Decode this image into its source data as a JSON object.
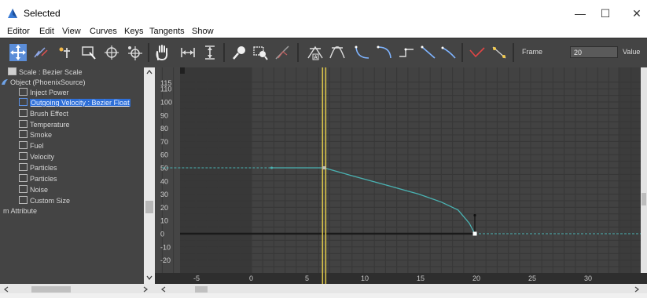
{
  "window": {
    "title": "Selected",
    "minimize": "—",
    "maximize": "☐",
    "close": "✕"
  },
  "menu": [
    "Editor",
    "Edit",
    "View",
    "Curves",
    "Keys",
    "Tangents",
    "Show"
  ],
  "toolbar": {
    "icons": [
      "move-keys-icon",
      "draw-curves-icon",
      "insert-keys-icon",
      "region-tool-icon",
      "retime-tool-icon",
      "retime-all-icon",
      "pan-icon",
      "zoom-horizontal-extents-icon",
      "zoom-value-extents-icon",
      "zoom-icon",
      "zoom-region-icon",
      "isolate-curve-icon",
      "auto-tangent-icon",
      "spline-tangent-icon",
      "fast-tangent-icon",
      "slow-tangent-icon",
      "step-tangent-icon",
      "linear-tangent-icon",
      "smooth-tangent-icon",
      "show-tangents-icon",
      "lock-tangents-icon"
    ],
    "frame_label": "Frame",
    "frame_value": "20",
    "value_label": "Value"
  },
  "tree": [
    {
      "label": "Scale : Bezier Scale",
      "indent": 1,
      "icon": "scale-track-icon",
      "selected": false
    },
    {
      "label": "Object (PhoenixSource)",
      "indent": 0,
      "icon": "object-icon",
      "selected": false
    },
    {
      "label": "Inject Power",
      "indent": 1,
      "icon": "track-icon",
      "selected": false
    },
    {
      "label": "Outgoing Velocity : Bezier Float",
      "indent": 1,
      "icon": "track-icon",
      "selected": true
    },
    {
      "label": "Brush Effect",
      "indent": 1,
      "icon": "track-icon",
      "selected": false
    },
    {
      "label": "Temperature",
      "indent": 1,
      "icon": "track-icon",
      "selected": false
    },
    {
      "label": "Smoke",
      "indent": 1,
      "icon": "track-icon",
      "selected": false
    },
    {
      "label": "Fuel",
      "indent": 1,
      "icon": "track-icon",
      "selected": false
    },
    {
      "label": "Velocity",
      "indent": 1,
      "icon": "track-icon",
      "selected": false
    },
    {
      "label": "Particles",
      "indent": 1,
      "icon": "track-icon",
      "selected": false
    },
    {
      "label": "Particles",
      "indent": 1,
      "icon": "track-icon",
      "selected": false
    },
    {
      "label": "Noise",
      "indent": 1,
      "icon": "track-icon",
      "selected": false
    },
    {
      "label": "Custom Size",
      "indent": 1,
      "icon": "track-icon",
      "selected": false
    },
    {
      "label": "m Attribute",
      "indent": -1,
      "icon": "",
      "selected": false
    }
  ],
  "graph": {
    "y_ticks": [
      110,
      100,
      90,
      80,
      70,
      60,
      50,
      40,
      30,
      20,
      10,
      0,
      -10,
      -20
    ],
    "y_top_partial": "115",
    "x_ticks": [
      -5,
      0,
      5,
      10,
      15,
      20,
      25,
      30
    ],
    "current_frame": 6.5,
    "keys": [
      {
        "frame": 6.5,
        "value": 50
      },
      {
        "frame": 20,
        "value": 0
      }
    ],
    "curve_points": [
      [
        6.5,
        50
      ],
      [
        9,
        44
      ],
      [
        12,
        37
      ],
      [
        15,
        30
      ],
      [
        17,
        24
      ],
      [
        18.5,
        18
      ],
      [
        19.5,
        8
      ],
      [
        20,
        0
      ]
    ],
    "pre_out_of_range_start": -8,
    "post_out_of_range_end": 30,
    "colors": {
      "curve": "#4ab3b3",
      "timebar": "#d9c44a",
      "active_range": "#4c4c4c",
      "inactive_range": "#3c3c3c"
    }
  }
}
